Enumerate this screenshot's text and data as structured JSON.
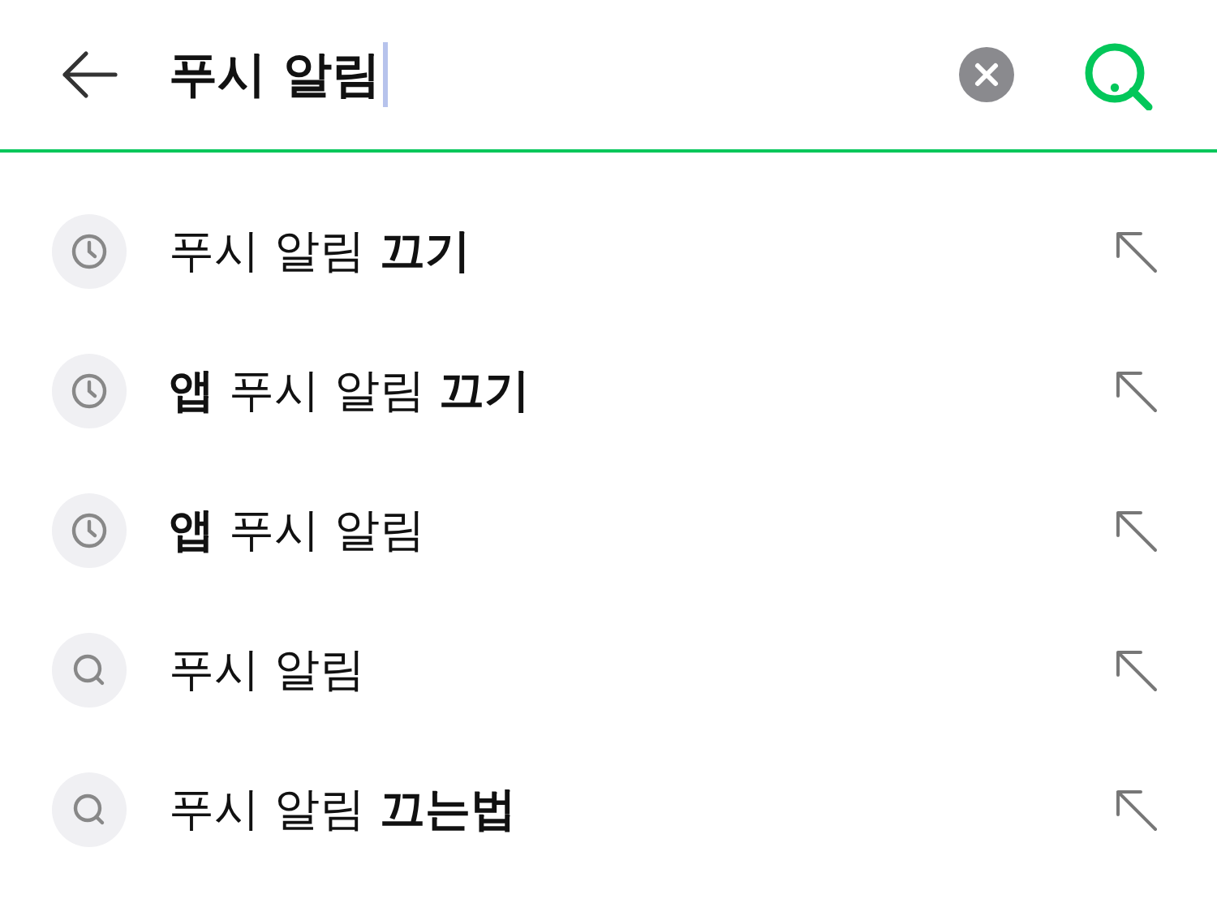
{
  "search_bar": {
    "query": "푸시 알림",
    "focused": true
  },
  "suggestions": [
    {
      "kind": "history",
      "text": "푸시 알림 **끄기**"
    },
    {
      "kind": "history",
      "text": "**앱** 푸시 알림 **끄기**"
    },
    {
      "kind": "history",
      "text": "**앱** 푸시 알림"
    },
    {
      "kind": "search",
      "text": "푸시 알림"
    },
    {
      "kind": "search",
      "text": "푸시 알림 **끄는법**"
    }
  ]
}
